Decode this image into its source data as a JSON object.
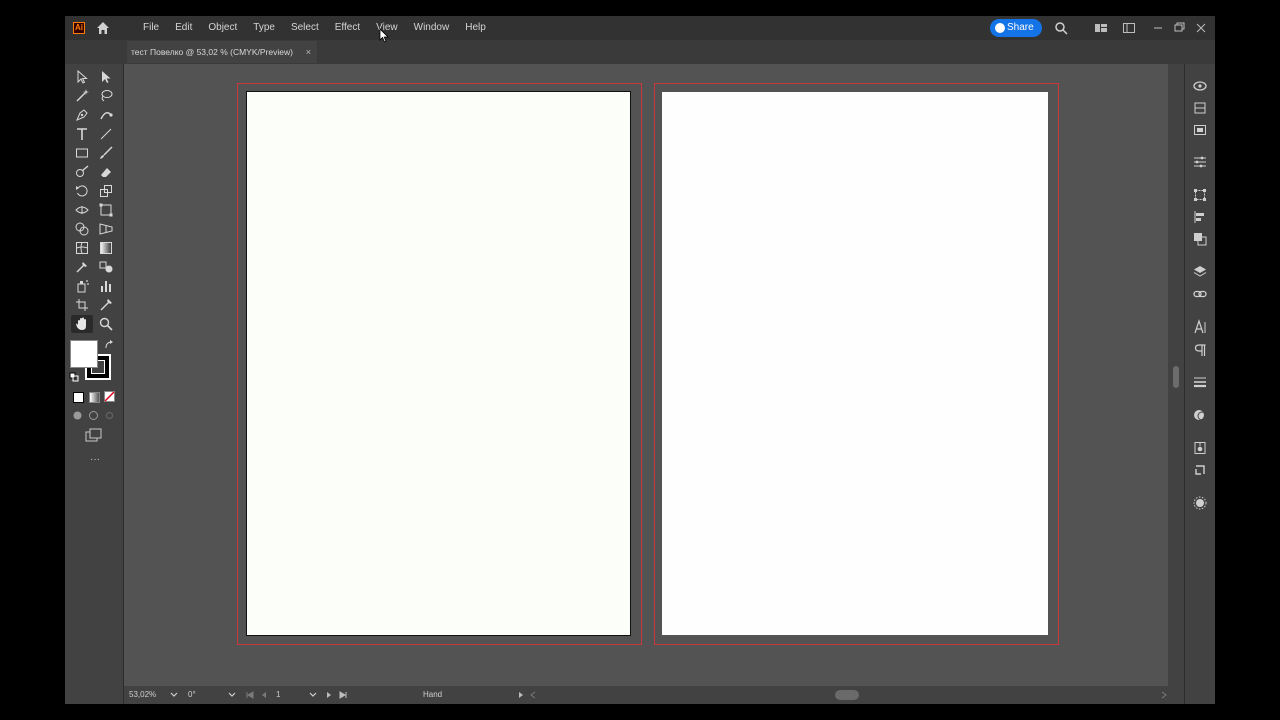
{
  "app": {
    "logo_text": "Ai",
    "menu": [
      "File",
      "Edit",
      "Object",
      "Type",
      "Select",
      "Effect",
      "View",
      "Window",
      "Help"
    ],
    "share_label": "Share"
  },
  "document_tab": {
    "title": "тест Повелко @ 53,02 % (CMYK/Preview)",
    "close_glyph": "×"
  },
  "statusbar": {
    "zoom": "53,02%",
    "rotation": "0°",
    "artboard_number": "1",
    "active_tool": "Hand"
  },
  "toolbar": {
    "more_glyph": "···"
  },
  "colors": {
    "fill": "#ffffff",
    "stroke": "#000000",
    "bleed": "#c8383a",
    "share_accent": "#1473e6"
  }
}
